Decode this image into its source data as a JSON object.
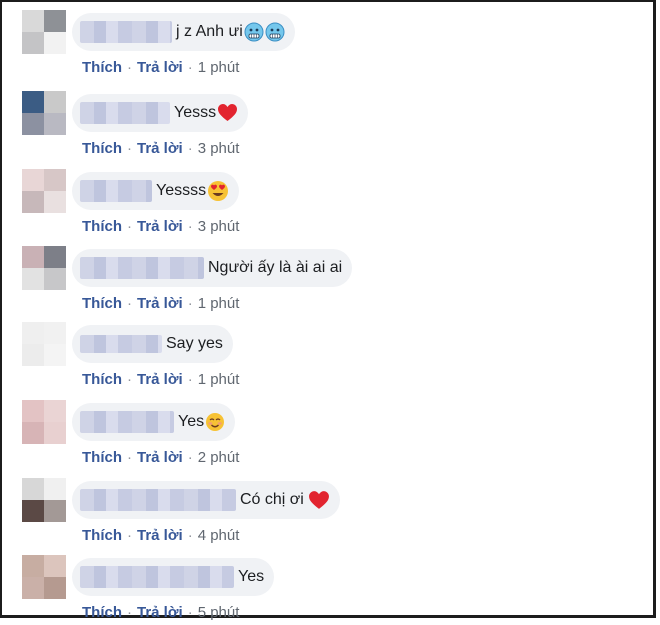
{
  "comments": [
    {
      "text": "j z Anh ưi",
      "emojis": [
        "cold-face-emoji",
        "cold-face-emoji"
      ],
      "like": "Thích",
      "reply": "Trả lời",
      "time": "1 phút",
      "avatar_colors": [
        "#d9d9d9",
        "#8e9196",
        "#c4c4c6",
        "#f2f2f2"
      ]
    },
    {
      "text": "Yesss",
      "emojis": [
        "red-heart-emoji"
      ],
      "like": "Thích",
      "reply": "Trả lời",
      "time": "3 phút",
      "avatar_colors": [
        "#3b5c84",
        "#c9c9c9",
        "#8c91a1",
        "#b9b9c2"
      ]
    },
    {
      "text": "Yessss",
      "emojis": [
        "heart-eyes-emoji"
      ],
      "like": "Thích",
      "reply": "Trả lời",
      "time": "3 phút",
      "avatar_colors": [
        "#e8d6d6",
        "#d7c7c7",
        "#c7b8ba",
        "#e9e0e0"
      ]
    },
    {
      "text": "Người ấy là ài ai ai",
      "emojis": [],
      "like": "Thích",
      "reply": "Trả lời",
      "time": "1 phút",
      "avatar_colors": [
        "#c9b1b5",
        "#7d7f88",
        "#e2e2e2",
        "#c7c7c9"
      ]
    },
    {
      "text": "Say yes",
      "emojis": [],
      "like": "Thích",
      "reply": "Trả lời",
      "time": "1 phút",
      "avatar_colors": [
        "#efefef",
        "#f1f1f1",
        "#ececec",
        "#f4f4f4"
      ]
    },
    {
      "text": "Yes",
      "emojis": [
        "smiling-face-emoji"
      ],
      "like": "Thích",
      "reply": "Trả lời",
      "time": "2 phút",
      "avatar_colors": [
        "#e3c3c4",
        "#ead4d4",
        "#d7b4b6",
        "#e8d0d0"
      ]
    },
    {
      "text": "Có chị ơi",
      "emojis": [
        "red-heart-emoji"
      ],
      "like": "Thích",
      "reply": "Trả lời",
      "time": "4 phút",
      "avatar_colors": [
        "#d7d7d7",
        "#f0f0f0",
        "#5b4945",
        "#a39996"
      ]
    },
    {
      "text": "Yes",
      "emojis": [],
      "like": "Thích",
      "reply": "Trả lời",
      "time": "5 phút",
      "avatar_colors": [
        "#c7ada2",
        "#dcc5bd",
        "#cab0a8",
        "#b59a90"
      ]
    }
  ],
  "colors": {
    "link": "#385898",
    "bubble": "#f0f2f5",
    "text": "#1c1e21",
    "meta": "#606770"
  }
}
